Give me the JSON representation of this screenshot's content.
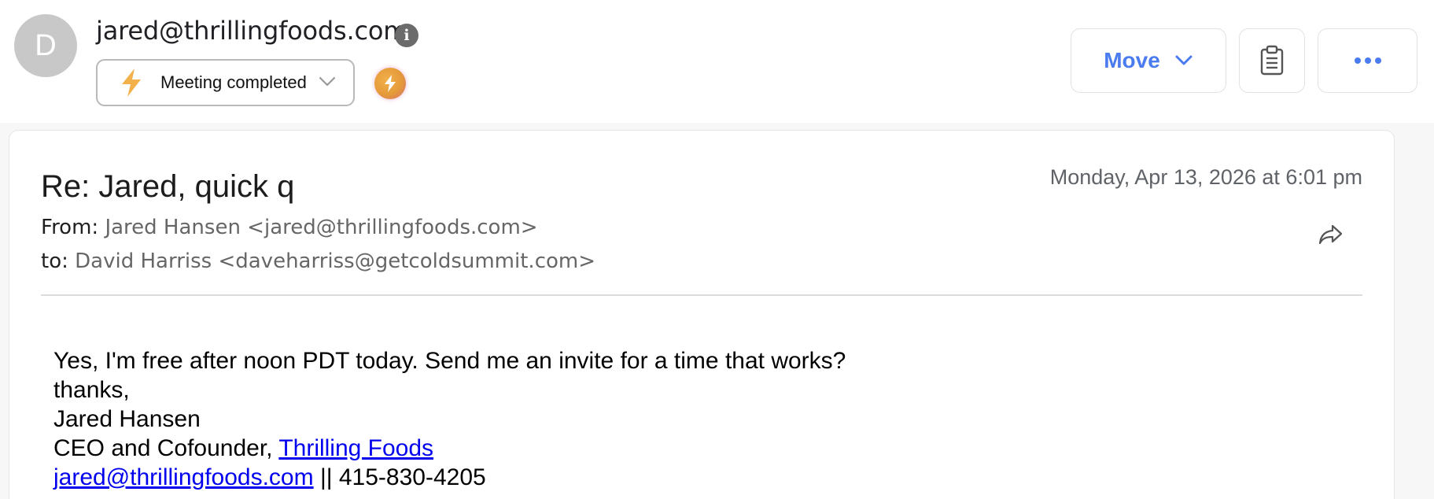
{
  "header": {
    "avatar_initial": "D",
    "sender_email": "jared@thrillingfoods.com",
    "info_icon": "info-icon",
    "status": {
      "label": "Meeting completed",
      "icon": "lightning-bolt-icon",
      "dropdown_icon": "chevron-down-icon"
    },
    "zap_badge_icon": "lightning-bolt-badge-icon",
    "buttons": {
      "move_label": "Move",
      "notes_icon": "clipboard-icon",
      "more_icon": "more-horizontal-icon"
    },
    "colors": {
      "accent": "#4a7bef",
      "bolt": "#f2b14a",
      "avatar": "#c8c8c8"
    }
  },
  "message": {
    "subject": "Re: Jared, quick q",
    "datetime": "Monday, Apr 13, 2026 at 6:01 pm",
    "from_label": "From:",
    "from_value": "Jared Hansen <jared@thrillingfoods.com>",
    "to_label": "to:",
    "to_value": "David Harriss <daveharriss@getcoldsummit.com>",
    "forward_icon": "forward-icon",
    "body": {
      "line1": "Yes, I'm free after noon PDT today. Send me an invite for a time that works?",
      "line2": "thanks,",
      "line3": "Jared Hansen",
      "title_prefix": "CEO and Cofounder, ",
      "company_link": "Thrilling Foods",
      "email_link": "jared@thrillingfoods.com",
      "phone_suffix": " || 415-830-4205"
    }
  }
}
